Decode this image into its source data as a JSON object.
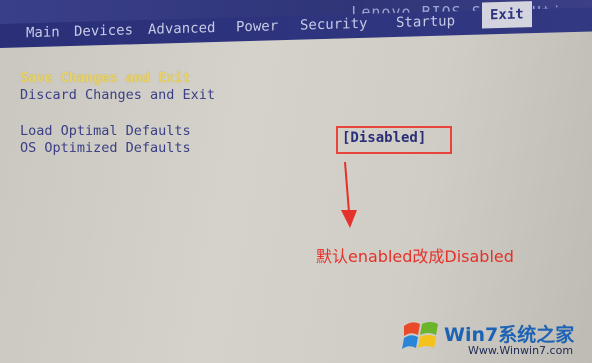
{
  "header": {
    "bios_title": "Lenovo BIOS Setup Uti"
  },
  "menu": {
    "items": [
      {
        "label": "Main"
      },
      {
        "label": "Devices"
      },
      {
        "label": "Advanced"
      },
      {
        "label": "Power"
      },
      {
        "label": "Security"
      },
      {
        "label": "Startup"
      },
      {
        "label": "Exit"
      }
    ],
    "active": "Exit"
  },
  "options": [
    {
      "label": "Save Changes and Exit",
      "selected": true
    },
    {
      "label": "Discard Changes and Exit"
    },
    {
      "label": "Load Optimal Defaults"
    },
    {
      "label": "OS Optimized Defaults"
    }
  ],
  "value": {
    "text": "[Disabled]"
  },
  "annotation": {
    "text": "默认enabled改成Disabled"
  },
  "watermark": {
    "name": "Win7系统之家",
    "url": "Www.Winwin7.com"
  },
  "colors": {
    "menubar": "#2f3577",
    "selected_text": "#e8d36a",
    "option_text": "#3a3f86",
    "annotation": "#e5312b",
    "value_border": "#e8443a"
  }
}
